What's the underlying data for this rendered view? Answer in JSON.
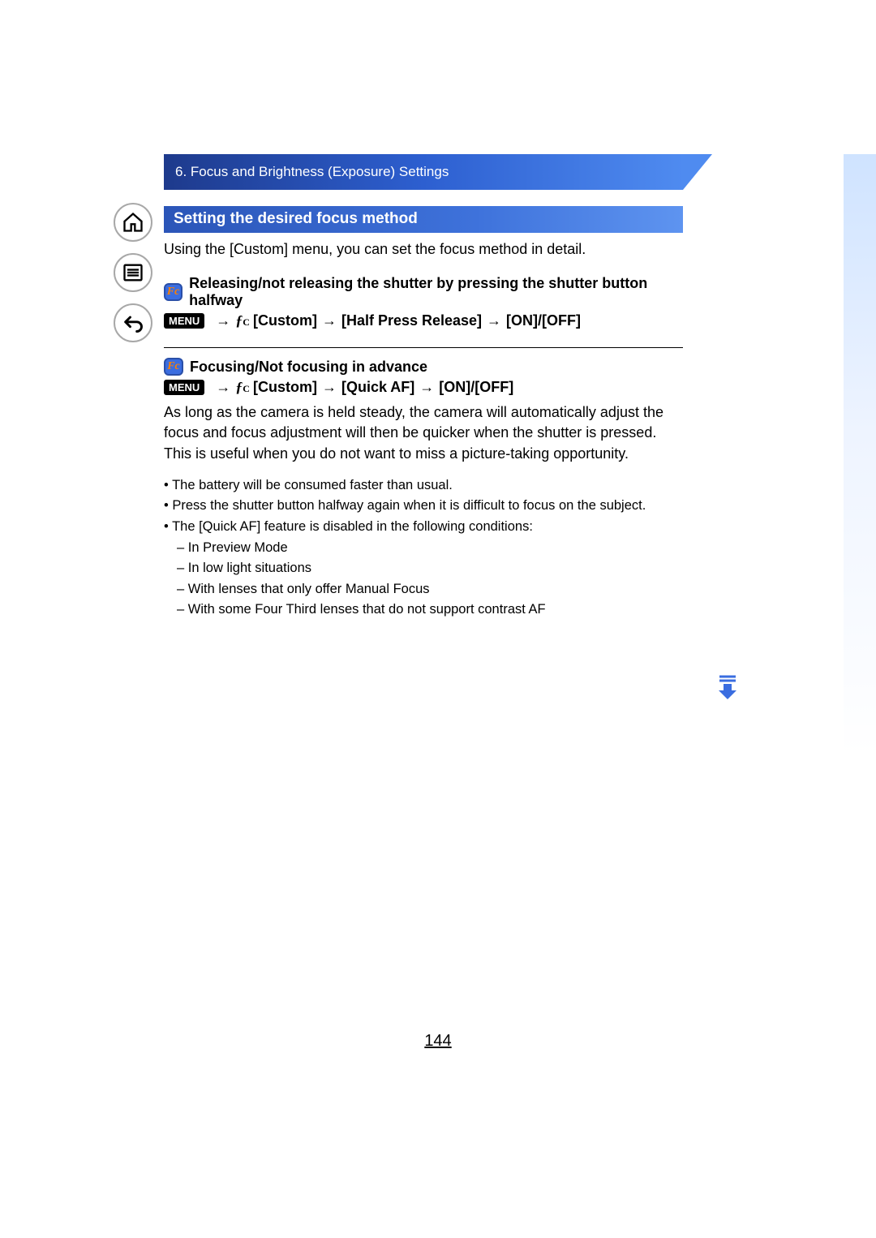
{
  "header": {
    "breadcrumb": "6. Focus and Brightness (Exposure) Settings"
  },
  "nav": {
    "home": "home-icon",
    "toc": "toc-icon",
    "back": "back-icon"
  },
  "section": {
    "title": "Setting the desired focus method",
    "intro": "Using the [Custom] menu, you can set the focus method in detail."
  },
  "sub1": {
    "icon_text": "Fc",
    "title": "Releasing/not releasing the shutter by pressing the shutter button halfway",
    "menu_label": "MENU",
    "fc_glyph": "ƒ",
    "fc_sub": "C",
    "path_custom": "[Custom]",
    "path_item": "[Half Press Release]",
    "path_option": "[ON]/[OFF]"
  },
  "sub2": {
    "icon_text": "Fc",
    "title": "Focusing/Not focusing in advance",
    "menu_label": "MENU",
    "fc_glyph": "ƒ",
    "fc_sub": "C",
    "path_custom": "[Custom]",
    "path_item": "[Quick AF]",
    "path_option": "[ON]/[OFF]",
    "body": "As long as the camera is held steady, the camera will automatically adjust the focus and focus adjustment will then be quicker when the shutter is pressed. This is useful when you do not want to miss a picture-taking opportunity.",
    "notes": [
      "The battery will be consumed faster than usual.",
      "Press the shutter button halfway again when it is difficult to focus on the subject.",
      "The [Quick AF] feature is disabled in the following conditions:"
    ],
    "conditions": [
      "In Preview Mode",
      "In low light situations",
      "With lenses that only offer Manual Focus",
      "With some Four Third lenses that do not support contrast AF"
    ]
  },
  "arrow": "→",
  "page_number": "144"
}
